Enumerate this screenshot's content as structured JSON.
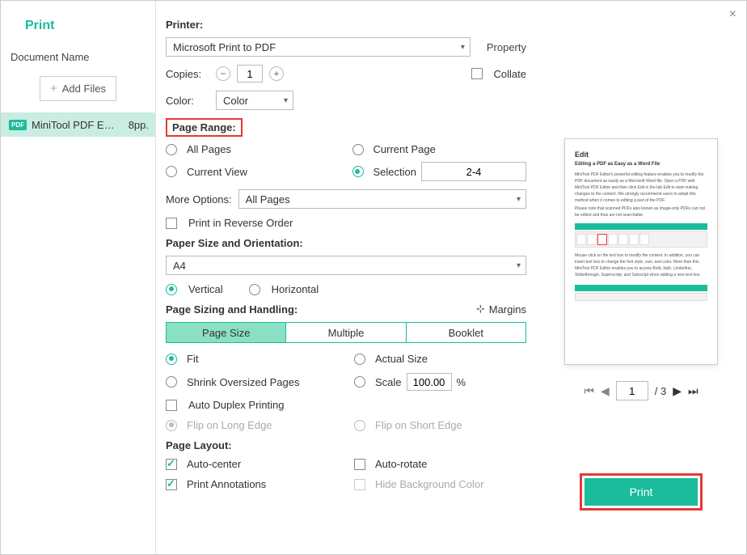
{
  "title": "Print",
  "sidebar": {
    "doc_label": "Document Name",
    "add_files": "Add Files",
    "file": {
      "name": "MiniTool PDF E…",
      "pages": "8pp."
    }
  },
  "printer": {
    "label": "Printer:",
    "selected": "Microsoft Print to PDF",
    "property": "Property"
  },
  "copies": {
    "label": "Copies:",
    "value": "1",
    "collate": "Collate"
  },
  "color": {
    "label": "Color:",
    "selected": "Color"
  },
  "range": {
    "label": "Page Range:",
    "all": "All Pages",
    "current_page": "Current Page",
    "current_view": "Current View",
    "selection": "Selection",
    "selection_value": "2-4",
    "more_options": "More Options:",
    "more_selected": "All Pages",
    "reverse": "Print in Reverse Order"
  },
  "paper": {
    "label": "Paper Size and Orientation:",
    "size": "A4",
    "vertical": "Vertical",
    "horizontal": "Horizontal"
  },
  "sizing": {
    "label": "Page Sizing and Handling:",
    "margins": "Margins",
    "tabs": {
      "page_size": "Page Size",
      "multiple": "Multiple",
      "booklet": "Booklet"
    },
    "fit": "Fit",
    "actual": "Actual Size",
    "shrink": "Shrink Oversized Pages",
    "scale": "Scale",
    "scale_value": "100.00",
    "scale_unit": "%"
  },
  "duplex": {
    "auto": "Auto Duplex Printing",
    "long": "Flip on Long Edge",
    "short": "Flip on Short Edge"
  },
  "layout": {
    "label": "Page Layout:",
    "auto_center": "Auto-center",
    "auto_rotate": "Auto-rotate",
    "annotations": "Print Annotations",
    "hide_bg": "Hide Background Color"
  },
  "preview": {
    "heading": "Edit",
    "sub": "Editing a PDF as Easy as a Word File",
    "nav_page": "1",
    "nav_total": "/ 3"
  },
  "print_btn": "Print"
}
